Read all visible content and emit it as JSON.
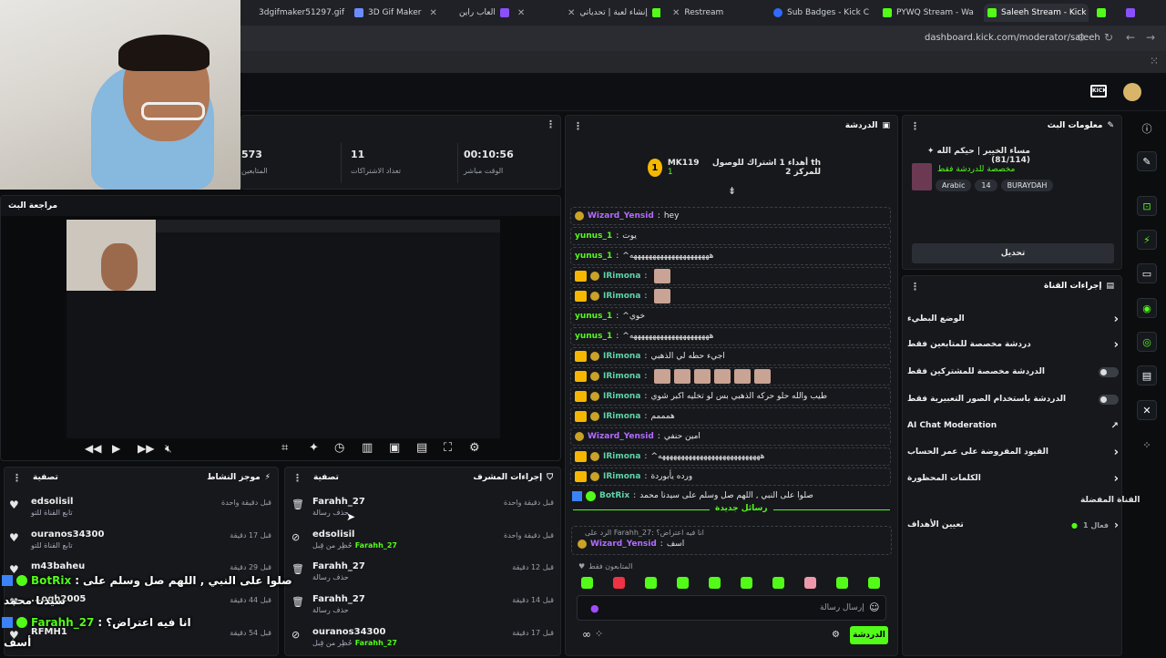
{
  "browser": {
    "tabs": [
      {
        "label": "3dgifmaker51297.gif",
        "color": "#888"
      },
      {
        "label": "3D Gif Maker",
        "color": "#6b8cff"
      },
      {
        "label": "العاب راين",
        "color": "#e0c040"
      },
      {
        "label": "إنشاء لعبة | تحدياتي",
        "color": "#8a4fff"
      },
      {
        "label": "Restream",
        "color": "#4fa0ff"
      },
      {
        "label": "Sub Badges - Kick C",
        "color": "#2f6bff"
      },
      {
        "label": "PYWQ Stream - Wa",
        "color": "#53fc18"
      },
      {
        "label": "Saleeh Stream - Kick",
        "color": "#53fc18"
      }
    ],
    "url": "dashboard.kick.com/moderator/saleeh"
  },
  "stats": {
    "followers_value": "573",
    "followers_label": "المتابعين",
    "subs_value": "11",
    "subs_label": "تعداد الاشتراكات",
    "uptime_value": "00:10:56",
    "uptime_label": "الوقت مباشر"
  },
  "stream_preview": {
    "title": "مراجعة البث"
  },
  "activity_feed": {
    "title": "موجز النشاط",
    "filter": "تصفية",
    "items": [
      {
        "name": "edsolisil",
        "sub": "تابع القناة للتو",
        "time": "قبل دقيقة واحدة"
      },
      {
        "name": "ouranos34300",
        "sub": "تابع القناة للتو",
        "time": "قبل 17 دقيقة"
      },
      {
        "name": "m43baheu",
        "sub": "",
        "time": "قبل 29 دقيقة"
      },
      {
        "name": "...oqh2005",
        "sub": "",
        "time": "قبل 44 دقيقة"
      },
      {
        "name": "RFMH1",
        "sub": "",
        "time": "قبل 54 دقيقة"
      }
    ]
  },
  "mod_actions": {
    "title": "إجراءات المشرف",
    "filter": "تصفية",
    "items": [
      {
        "name": "Farahh_27",
        "sub": "حذف رسالة",
        "time": "قبل دقيقة واحدة",
        "target": ""
      },
      {
        "name": "edsolisil",
        "sub": "حُظِر من قِبل",
        "time": "قبل دقيقة واحدة",
        "target": "Farahh_27"
      },
      {
        "name": "Farahh_27",
        "sub": "حذف رسالة",
        "time": "قبل 12 دقيقة",
        "target": ""
      },
      {
        "name": "Farahh_27",
        "sub": "حذف رسالة",
        "time": "قبل 14 دقيقة",
        "target": ""
      },
      {
        "name": "ouranos34300",
        "sub": "حُظِر من قِبل",
        "time": "قبل 17 دقيقة",
        "target": "Farahh_27"
      }
    ]
  },
  "chat": {
    "title": "الدردشة",
    "pinned_user": "MK119",
    "pinned_count": "1",
    "pinned_text": "أهداء 1 اشتراك للوصول للمركز 2",
    "pinned_suffix": "th",
    "messages": [
      {
        "user": "Wizard_Yensid",
        "text": "hey",
        "color": "purple",
        "badges": "sword"
      },
      {
        "user": "yunus_1",
        "text": "يوت",
        "color": "green",
        "badges": ""
      },
      {
        "user": "yunus_1",
        "text": "^هههههههههههههههههههههه",
        "color": "green",
        "badges": ""
      },
      {
        "user": "IRimona",
        "text": "",
        "color": "teal",
        "badges": "crown",
        "emotes": 1
      },
      {
        "user": "IRimona",
        "text": "",
        "color": "teal",
        "badges": "crown",
        "emotes": 1
      },
      {
        "user": "yunus_1",
        "text": "^خوي",
        "color": "green",
        "badges": ""
      },
      {
        "user": "yunus_1",
        "text": "^هههههههههههههههههههههه",
        "color": "green",
        "badges": ""
      },
      {
        "user": "IRimona",
        "text": "اجيء حطه لي الذهبي",
        "color": "teal",
        "badges": "crown"
      },
      {
        "user": "IRimona",
        "text": "",
        "color": "teal",
        "badges": "crown",
        "emotes": 6
      },
      {
        "user": "IRimona",
        "text": "طيب والله حلو حركه الذهبي بس لو تخليه اكبر شوي",
        "color": "teal",
        "badges": "crown"
      },
      {
        "user": "IRimona",
        "text": "همممم",
        "color": "teal",
        "badges": "crown"
      },
      {
        "user": "Wizard_Yensid",
        "text": "امين حنفي",
        "color": "purple",
        "badges": "sword"
      },
      {
        "user": "IRimona",
        "text": "^هههههههههههههههههههههههههههه",
        "color": "teal",
        "badges": "crown"
      },
      {
        "user": "IRimona",
        "text": "ورده يأبوردة",
        "color": "teal",
        "badges": "crown"
      }
    ],
    "botrix_user": "BotRix",
    "botrix_text": "صلوا على النبي , اللهم صل وسلم على سيدنا محمد",
    "new_messages": "رسائل جديدة",
    "reply_to": "الرد على Farahh_27: انا فيه اعتراض؟",
    "reply_user": "Wizard_Yensid",
    "reply_text": "اسف",
    "followers_only": "المتابعون فقط",
    "input_placeholder": "إرسال رسالة",
    "send_label": "الدردشة"
  },
  "stream_info": {
    "title": "معلومات البث",
    "stream_title": "مساء الخيير | حيكم الله ✦ (81/114)",
    "category": "مخصصة للدردشة فقط",
    "tags": [
      "Arabic",
      "14",
      "BURAYDAH"
    ],
    "edit": "تحديل"
  },
  "channel_actions": {
    "title": "إجراءات القناة",
    "items": [
      {
        "label": "الوضع البطيء",
        "control": "chevron"
      },
      {
        "label": "دردشة مخصصة للمتابعين فقط",
        "control": "chevron"
      },
      {
        "label": "الدردشة مخصصة للمشتركين فقط",
        "control": "toggle"
      },
      {
        "label": "الدردشة باستخدام الصور التعبيرية فقط",
        "control": "toggle"
      },
      {
        "label": "AI Chat Moderation",
        "control": "external"
      },
      {
        "label": "القيود المفروضة على عمر الحساب",
        "control": "chevron"
      },
      {
        "label": "الكلمات المحظورة",
        "control": "chevron"
      }
    ],
    "favorites_title": "القناة المفضلة",
    "goals_label": "تعيين الأهداف",
    "goals_status": "فعال 1"
  },
  "overlay": {
    "botrix_user": "BotRix",
    "botrix_line1": "صلوا على النبي , اللهم صل وسلم على",
    "botrix_line2": "سيدنا محمد",
    "farahh_user": "Farahh_27",
    "farahh_text": "انا فيه اعتراض؟",
    "asif": "أسف"
  }
}
